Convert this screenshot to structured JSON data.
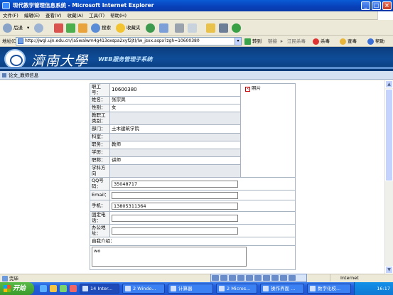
{
  "window": {
    "title": "现代教学管理信息系统 - Microsoft Internet Explorer",
    "btn_min": "_",
    "btn_max": "□",
    "btn_close": "×"
  },
  "menu": [
    "文件(F)",
    "编辑(E)",
    "查看(V)",
    "收藏(A)",
    "工具(T)",
    "帮助(H)"
  ],
  "toolbar": {
    "back": "后退",
    "search": "搜索",
    "favorites": "收藏夹",
    "arrow": "▾"
  },
  "address": {
    "label": "地址(D)",
    "url": "http://jwgl.ujn.edu.cn/(a5walwm4g413oxspa2xyf2jt)/lw_jsxx.aspx?zgh=10600380",
    "go": "转到",
    "links": "链接",
    "more": "»",
    "extra1": "江民杀毒",
    "extra2": "杀毒",
    "query": "查毒",
    "help": "帮助"
  },
  "banner": {
    "school": "濟南大學",
    "system": "WEB服务管理子系统"
  },
  "breadcrumb": "论文_教师信息",
  "form": {
    "photo_label": "照片",
    "photo_icon": "×",
    "rows": [
      {
        "label": "职工号：",
        "value": "10600380"
      },
      {
        "label": "姓名：",
        "value": "张宗凤"
      },
      {
        "label": "性别：",
        "value": "女"
      },
      {
        "label": "教职工类别：",
        "value": ""
      },
      {
        "label": "部门：",
        "value": "土木建筑学院"
      },
      {
        "label": "科室：",
        "value": ""
      },
      {
        "label": "职务：",
        "value": "教师"
      },
      {
        "label": "学历：",
        "value": ""
      },
      {
        "label": "职称：",
        "value": "讲师"
      },
      {
        "label": "学科方向",
        "value": ""
      }
    ],
    "inputs": [
      {
        "label": "QQ号码：",
        "value": "35048717"
      },
      {
        "label": "Email：",
        "value": ""
      },
      {
        "label": "手机：",
        "value": "13805311364"
      },
      {
        "label": "固定电话：",
        "value": ""
      },
      {
        "label": "办公地址：",
        "value": ""
      }
    ],
    "intro_label": "自我介绍：",
    "intro_value": "wo"
  },
  "status": {
    "left": "完毕",
    "zone": "Internet"
  },
  "taskbar": {
    "start": "开始",
    "tasks": [
      "14 Inter...",
      "2 Windo...",
      "计算器",
      "2 Micros...",
      "操作界面 ...",
      "数字化校..."
    ],
    "clock": "16:17"
  }
}
